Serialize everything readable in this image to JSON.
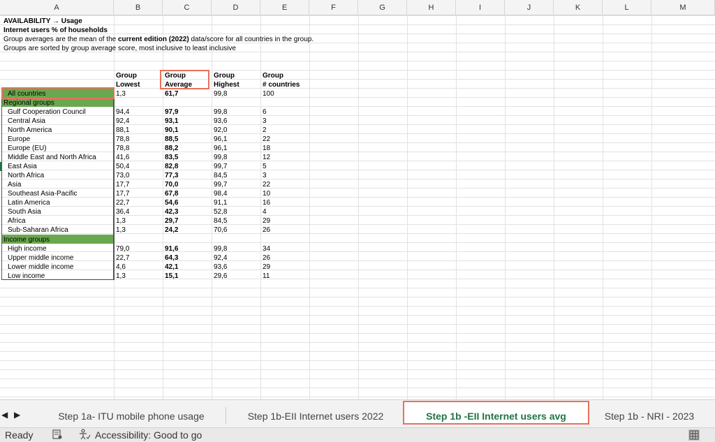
{
  "columns": [
    "A",
    "B",
    "C",
    "D",
    "E",
    "F",
    "G",
    "H",
    "I",
    "J",
    "K",
    "L",
    "M"
  ],
  "title": {
    "line1": "AVAILABILITY → Usage",
    "line2": "Internet users % of households",
    "line3_pre": "Group averages are the mean of the ",
    "line3_bold": "current edition (2022)",
    "line3_post": " data/score for all countries in the group.",
    "line4": "Groups are sorted by group average score, most inclusive to least inclusive"
  },
  "headers": {
    "lowest_1": "Group",
    "lowest_2": "Lowest",
    "average_1": "Group",
    "average_2": "Average",
    "highest_1": "Group",
    "highest_2": "Highest",
    "count_1": "Group",
    "count_2": "# countries"
  },
  "all_countries": {
    "name": "All countries",
    "lowest": "1,3",
    "average": "61,7",
    "highest": "99,8",
    "count": "100"
  },
  "sections": {
    "regional": "Regional groups",
    "income": "Income groups"
  },
  "regional_rows": [
    {
      "name": "Gulf Cooperation Council",
      "lowest": "94,4",
      "average": "97,9",
      "highest": "99,8",
      "count": "6"
    },
    {
      "name": "Central Asia",
      "lowest": "92,4",
      "average": "93,1",
      "highest": "93,6",
      "count": "3"
    },
    {
      "name": "North America",
      "lowest": "88,1",
      "average": "90,1",
      "highest": "92,0",
      "count": "2"
    },
    {
      "name": "Europe",
      "lowest": "78,8",
      "average": "88,5",
      "highest": "96,1",
      "count": "22"
    },
    {
      "name": "Europe (EU)",
      "lowest": "78,8",
      "average": "88,2",
      "highest": "96,1",
      "count": "18"
    },
    {
      "name": "Middle East and North Africa",
      "lowest": "41,6",
      "average": "83,5",
      "highest": "99,8",
      "count": "12"
    },
    {
      "name": "East Asia",
      "lowest": "50,4",
      "average": "82,8",
      "highest": "99,7",
      "count": "5"
    },
    {
      "name": "North Africa",
      "lowest": "73,0",
      "average": "77,3",
      "highest": "84,5",
      "count": "3"
    },
    {
      "name": "Asia",
      "lowest": "17,7",
      "average": "70,0",
      "highest": "99,7",
      "count": "22"
    },
    {
      "name": "Southeast Asia-Pacific",
      "lowest": "17,7",
      "average": "67,8",
      "highest": "98,4",
      "count": "10"
    },
    {
      "name": "Latin America",
      "lowest": "22,7",
      "average": "54,6",
      "highest": "91,1",
      "count": "16"
    },
    {
      "name": "South Asia",
      "lowest": "36,4",
      "average": "42,3",
      "highest": "52,8",
      "count": "4"
    },
    {
      "name": "Africa",
      "lowest": "1,3",
      "average": "29,7",
      "highest": "84,5",
      "count": "29"
    },
    {
      "name": "Sub-Saharan Africa",
      "lowest": "1,3",
      "average": "24,2",
      "highest": "70,6",
      "count": "26"
    }
  ],
  "income_rows": [
    {
      "name": "High income",
      "lowest": "79,0",
      "average": "91,6",
      "highest": "99,8",
      "count": "34"
    },
    {
      "name": "Upper middle income",
      "lowest": "22,7",
      "average": "64,3",
      "highest": "92,4",
      "count": "26"
    },
    {
      "name": "Lower middle income",
      "lowest": "4,6",
      "average": "42,1",
      "highest": "93,6",
      "count": "29"
    },
    {
      "name": "Low income",
      "lowest": "1,3",
      "average": "15,1",
      "highest": "29,6",
      "count": "11"
    }
  ],
  "tabs": [
    {
      "label": "Step 1a- ITU mobile phone usage",
      "active": false
    },
    {
      "label": "Step 1b-EII Internet users 2022",
      "active": false
    },
    {
      "label": "Step 1b -EII Internet users avg",
      "active": true
    },
    {
      "label": "Step 1b - NRI - 2023",
      "active": false
    }
  ],
  "status": {
    "ready": "Ready",
    "accessibility": "Accessibility: Good to go"
  },
  "colors": {
    "green_fill": "#6aa84f",
    "highlight_red": "#e8705e",
    "active_tab_text": "#217346"
  }
}
